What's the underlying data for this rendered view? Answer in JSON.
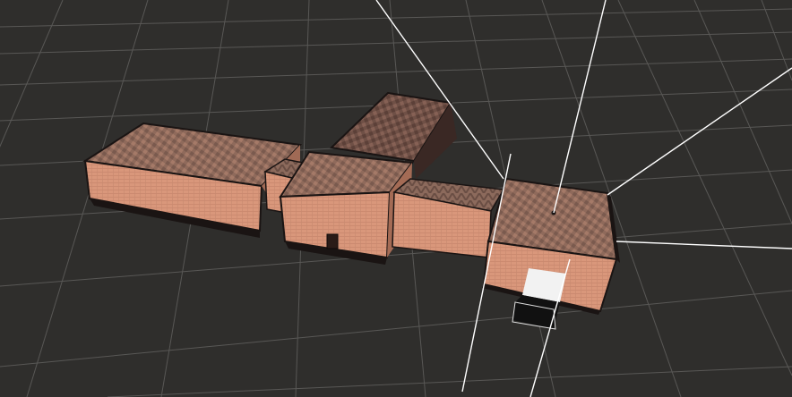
{
  "scene": {
    "background_color": "#2f2e2c",
    "grid_color": "#8a8a8a",
    "gizmo_color": "#ffffff",
    "wall_color": "#d8977a",
    "wall_shadow_color": "#c07d62",
    "roof_color": "#9a6e5c",
    "roof_dark_color": "#6d4e43",
    "base_color": "#1a1413",
    "selection_color": "#ffffff"
  },
  "objects": [
    {
      "id": "building-west",
      "type": "mesh"
    },
    {
      "id": "building-north",
      "type": "mesh"
    },
    {
      "id": "building-center",
      "type": "mesh"
    },
    {
      "id": "corridor-west",
      "type": "mesh"
    },
    {
      "id": "corridor-east",
      "type": "mesh"
    },
    {
      "id": "building-east",
      "type": "mesh"
    },
    {
      "id": "door",
      "type": "mesh"
    },
    {
      "id": "light-probe",
      "type": "gizmo"
    },
    {
      "id": "camera-frustum",
      "type": "gizmo"
    }
  ]
}
